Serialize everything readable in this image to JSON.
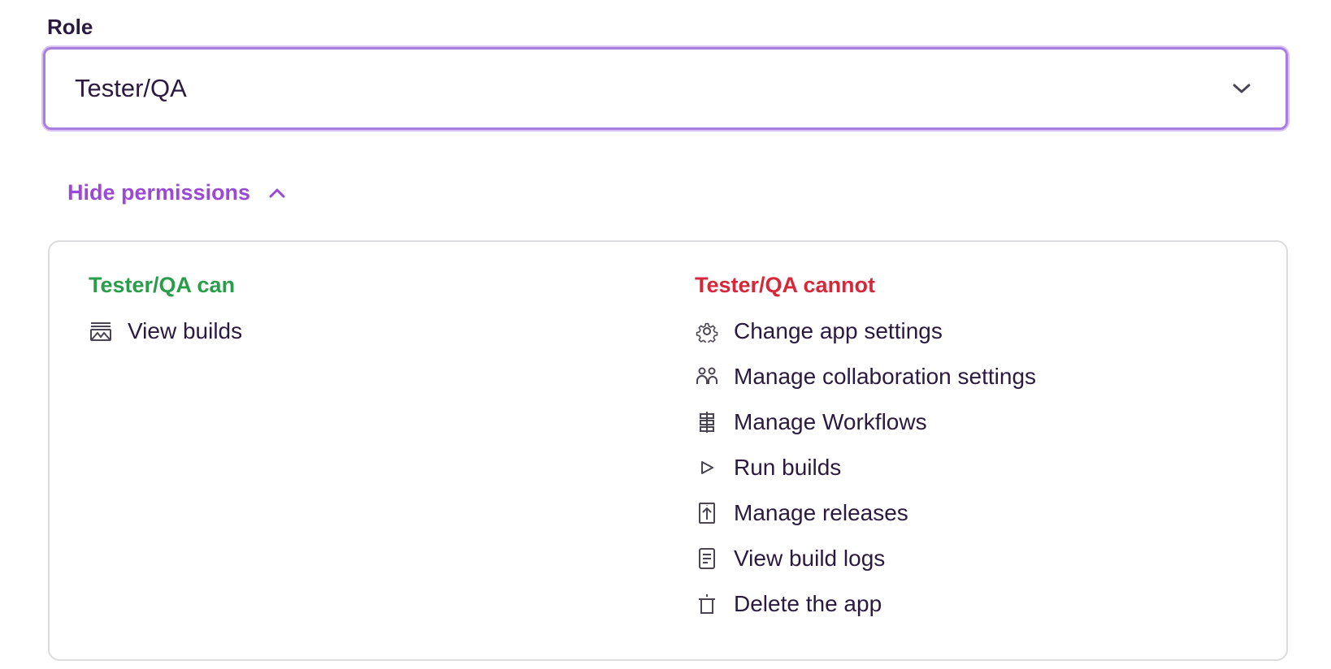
{
  "role": {
    "label": "Role",
    "selected": "Tester/QA"
  },
  "toggle": {
    "label": "Hide permissions"
  },
  "permissions": {
    "can": {
      "title": "Tester/QA can",
      "items": [
        {
          "label": "View builds",
          "icon": "builds-icon"
        }
      ]
    },
    "cannot": {
      "title": "Tester/QA cannot",
      "items": [
        {
          "label": "Change app settings",
          "icon": "gear-icon"
        },
        {
          "label": "Manage collaboration settings",
          "icon": "users-icon"
        },
        {
          "label": "Manage Workflows",
          "icon": "workflow-icon"
        },
        {
          "label": "Run builds",
          "icon": "play-icon"
        },
        {
          "label": "Manage releases",
          "icon": "release-icon"
        },
        {
          "label": "View build logs",
          "icon": "document-icon"
        },
        {
          "label": "Delete the app",
          "icon": "trash-icon"
        }
      ]
    }
  },
  "colors": {
    "accent": "#9a49d6",
    "focus_border": "#a87ee0",
    "can": "#2a9d4a",
    "cannot": "#d7283b",
    "text": "#2b1a3f",
    "icon": "#4b4453"
  }
}
